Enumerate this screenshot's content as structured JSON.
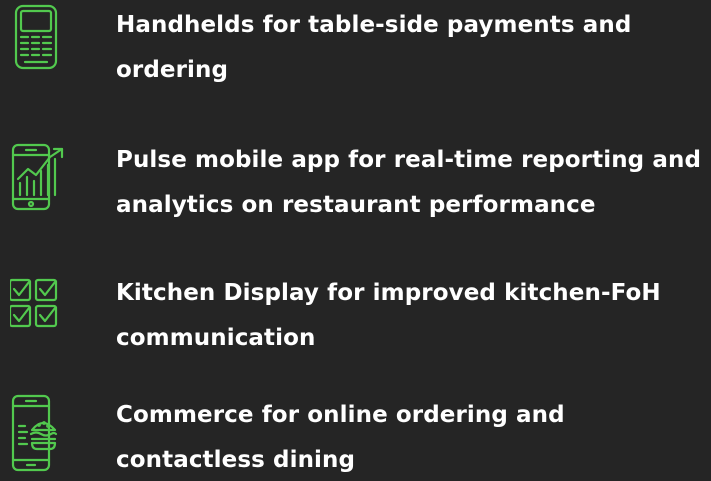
{
  "colors": {
    "background": "#252525",
    "text": "#ffffff",
    "accent": "#52c94e"
  },
  "features": [
    {
      "icon": "handheld-terminal-icon",
      "text": "Handhelds for table-side payments and ordering"
    },
    {
      "icon": "mobile-analytics-icon",
      "text": "Pulse mobile app for real-time reporting and analytics on restaurant performance"
    },
    {
      "icon": "checklist-grid-icon",
      "text": "Kitchen Display for improved kitchen-FoH communication"
    },
    {
      "icon": "phone-burger-icon",
      "text": "Commerce for online ordering and contactless dining"
    }
  ]
}
